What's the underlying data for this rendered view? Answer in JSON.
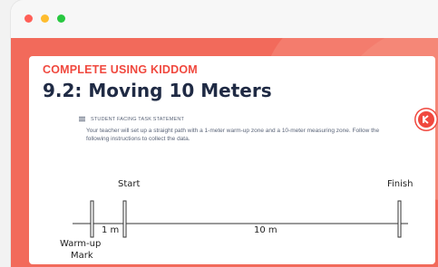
{
  "header": {
    "brand_line": "COMPLETE USING KIDDOM",
    "title": "9.2: Moving 10 Meters"
  },
  "statement": {
    "label": "STUDENT FACING TASK STATEMENT",
    "text": "Your teacher will set up a straight path with a 1-meter warm-up zone and a 10-meter measuring zone. Follow the following instructions to collect the data."
  },
  "diagram": {
    "start_label": "Start",
    "finish_label": "Finish",
    "warmup_length": "1 m",
    "measure_length": "10 m",
    "warmup_mark_line1": "Warm-up",
    "warmup_mark_line2": "Mark"
  },
  "colors": {
    "accent": "#f0483e",
    "background": "#f26a5b",
    "title": "#1f2a44"
  },
  "icons": {
    "side_logo": "kiddom-logo-icon",
    "statement_icon": "list-icon"
  }
}
